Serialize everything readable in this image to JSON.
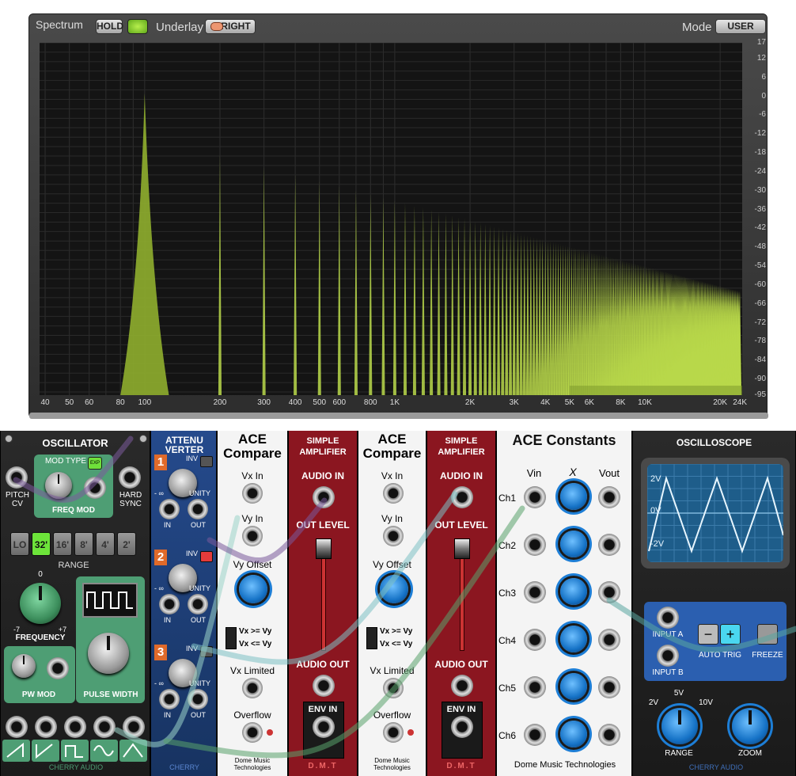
{
  "spectrum": {
    "title": "Spectrum",
    "hold_label": "HOLD",
    "underlay_label": "Underlay",
    "right_label": "RIGHT",
    "mode_label": "Mode",
    "mode_value": "USER",
    "db_ticks": [
      "17",
      "12",
      "6",
      "0",
      "-6",
      "-12",
      "-18",
      "-24",
      "-30",
      "-36",
      "-42",
      "-48",
      "-54",
      "-60",
      "-66",
      "-72",
      "-78",
      "-84",
      "-90",
      "-95"
    ],
    "freq_ticks": [
      "40",
      "50",
      "60",
      "80",
      "100",
      "200",
      "300",
      "400",
      "500",
      "600",
      "800",
      "1K",
      "2K",
      "3K",
      "4K",
      "5K",
      "6K",
      "8K",
      "10K",
      "20K",
      "24K"
    ],
    "colors": {
      "trace": "#b9d84a",
      "background": "#141414",
      "grid": "#2e2e2e"
    }
  },
  "oscillator": {
    "title": "OSCILLATOR",
    "mod_type": "MOD TYPE",
    "exp": "EXP",
    "pitch_cv": "PITCH CV",
    "hard_sync": "HARD SYNC",
    "freq_mod": "FREQ MOD",
    "range_buttons": [
      "LO",
      "32'",
      "16'",
      "8'",
      "4'",
      "2'"
    ],
    "range_label": "RANGE",
    "freq_zero": "0",
    "freq_min": "-7",
    "freq_max": "+7",
    "frequency": "FREQUENCY",
    "pw_mod": "PW MOD",
    "pulse_width": "PULSE WIDTH",
    "brand": "CHERRY AUDIO"
  },
  "attenuverter": {
    "title": "ATTENU VERTER",
    "channels": [
      "1",
      "2",
      "3"
    ],
    "inv": "INV",
    "neg_inf": "- ∞",
    "unity": "UNITY",
    "in": "IN",
    "out": "OUT",
    "brand": "CHERRY"
  },
  "compare1": {
    "title": "ACE Compare",
    "vx_in": "Vx In",
    "vy_in": "Vy In",
    "vy_offset": "Vy Offset",
    "cmp_ge": "Vx >= Vy",
    "cmp_le": "Vx <= Vy",
    "vx_limited": "Vx Limited",
    "overflow": "Overflow",
    "brand": "Dome Music Technologies"
  },
  "amp1": {
    "title": "SIMPLE AMPLIFIER",
    "audio_in": "AUDIO IN",
    "out_level": "OUT LEVEL",
    "audio_out": "AUDIO OUT",
    "env_in": "ENV IN",
    "brand": "D.M.T"
  },
  "compare2": {
    "title": "ACE Compare",
    "vx_in": "Vx In",
    "vy_in": "Vy In",
    "vy_offset": "Vy Offset",
    "cmp_ge": "Vx >= Vy",
    "cmp_le": "Vx <= Vy",
    "vx_limited": "Vx Limited",
    "overflow": "Overflow",
    "brand": "Dome Music Technologies"
  },
  "amp2": {
    "title": "SIMPLE AMPLIFIER",
    "audio_in": "AUDIO IN",
    "out_level": "OUT LEVEL",
    "audio_out": "AUDIO OUT",
    "env_in": "ENV IN",
    "brand": "D.M.T"
  },
  "constants": {
    "title": "ACE Constants",
    "vin": "Vin",
    "x": "X",
    "vout": "Vout",
    "channels": [
      "Ch1",
      "Ch2",
      "Ch3",
      "Ch4",
      "Ch5",
      "Ch6"
    ],
    "brand": "Dome Music Technologies"
  },
  "scope": {
    "title": "OSCILLOSCOPE",
    "y_labels": [
      "2V",
      "0V",
      "-2V"
    ],
    "input_a": "INPUT A",
    "input_b": "INPUT B",
    "minus": "−",
    "plus": "+",
    "auto_trig": "AUTO TRIG",
    "freeze": "FREEZE",
    "range_marks": [
      "2V",
      "5V",
      "10V"
    ],
    "range": "RANGE",
    "zoom": "ZOOM",
    "brand": "CHERRY AUDIO"
  }
}
